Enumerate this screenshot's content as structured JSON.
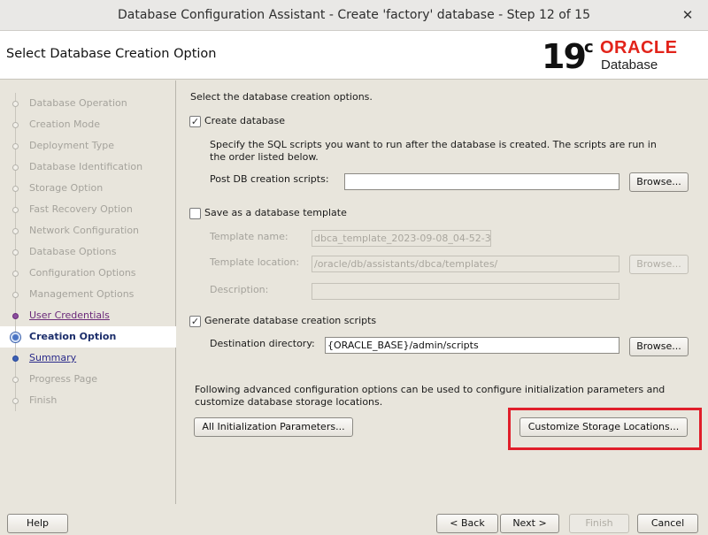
{
  "window": {
    "title": "Database Configuration Assistant - Create 'factory' database - Step 12 of 15",
    "close_glyph": "✕"
  },
  "header": {
    "page_title": "Select Database Creation Option",
    "logo": {
      "version": "19",
      "sup": "c",
      "brand": "ORACLE",
      "product": "Database"
    }
  },
  "sidebar": {
    "items": [
      {
        "label": "Database Operation",
        "state": "disabled"
      },
      {
        "label": "Creation Mode",
        "state": "disabled"
      },
      {
        "label": "Deployment Type",
        "state": "disabled"
      },
      {
        "label": "Database Identification",
        "state": "disabled"
      },
      {
        "label": "Storage Option",
        "state": "disabled"
      },
      {
        "label": "Fast Recovery Option",
        "state": "disabled"
      },
      {
        "label": "Network Configuration",
        "state": "disabled"
      },
      {
        "label": "Database Options",
        "state": "disabled"
      },
      {
        "label": "Configuration Options",
        "state": "disabled"
      },
      {
        "label": "Management Options",
        "state": "disabled"
      },
      {
        "label": "User Credentials",
        "state": "done"
      },
      {
        "label": "Creation Option",
        "state": "current"
      },
      {
        "label": "Summary",
        "state": "link"
      },
      {
        "label": "Progress Page",
        "state": "disabled"
      },
      {
        "label": "Finish",
        "state": "disabled"
      }
    ]
  },
  "main": {
    "intro": "Select the database creation options.",
    "create_db": {
      "label": "Create database",
      "checked": true
    },
    "sql_desc_1": "Specify the SQL scripts you want to run after the database is created. The scripts are run in",
    "sql_desc_2": "the order listed below.",
    "post_scripts": {
      "label": "Post DB creation scripts:",
      "value": "",
      "browse": "Browse..."
    },
    "save_template": {
      "label": "Save as a database template",
      "checked": false
    },
    "template_name": {
      "label": "Template name:",
      "value": "dbca_template_2023-09-08_04-52-3"
    },
    "template_location": {
      "label": "Template location:",
      "value": "/oracle/db/assistants/dbca/templates/",
      "browse": "Browse..."
    },
    "description": {
      "label": "Description:",
      "value": ""
    },
    "gen_scripts": {
      "label": "Generate database creation scripts",
      "checked": true
    },
    "destination": {
      "label": "Destination directory:",
      "value": "{ORACLE_BASE}/admin/scripts",
      "browse": "Browse..."
    },
    "advanced_1": "Following advanced configuration options can be used to configure initialization parameters and",
    "advanced_2": "customize database storage locations.",
    "init_params_button": "All Initialization Parameters...",
    "storage_button": "Customize Storage Locations...",
    "check_glyph": "✓"
  },
  "footer": {
    "help": "Help",
    "back": "< Back",
    "next": "Next >",
    "finish": "Finish",
    "cancel": "Cancel"
  },
  "colors": {
    "highlight": "#e01e2a",
    "oracle_red": "#e2231a"
  }
}
